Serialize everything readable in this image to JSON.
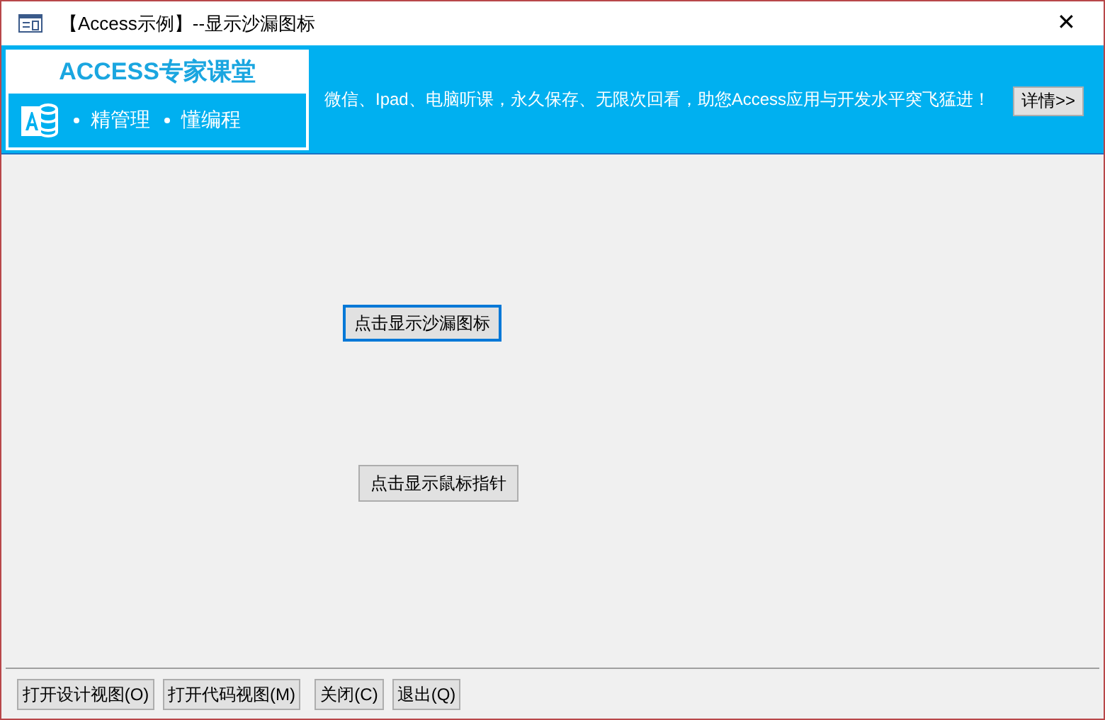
{
  "window": {
    "title": "【Access示例】--显示沙漏图标",
    "close": "✕"
  },
  "banner": {
    "logo_title": "ACCESS专家课堂",
    "logo_items": [
      "精管理",
      "懂编程"
    ],
    "message": "微信、Ipad、电脑听课，永久保存、无限次回看，助您Access应用与开发水平突飞猛进！",
    "details_button": "详情>>"
  },
  "form_buttons": [
    {
      "label": "点击显示沙漏图标",
      "focused": true
    },
    {
      "label": "点击显示鼠标指针",
      "focused": false
    }
  ],
  "footer_buttons": [
    "打开设计视图(O)",
    "打开代码视图(M)",
    "关闭(C)",
    "退出(Q)"
  ]
}
